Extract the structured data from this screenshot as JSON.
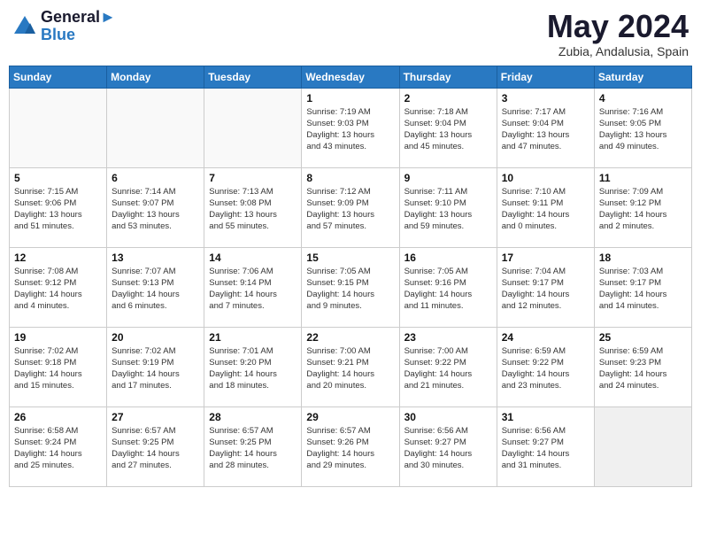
{
  "header": {
    "logo_line1": "General",
    "logo_line2": "Blue",
    "month": "May 2024",
    "location": "Zubia, Andalusia, Spain"
  },
  "weekdays": [
    "Sunday",
    "Monday",
    "Tuesday",
    "Wednesday",
    "Thursday",
    "Friday",
    "Saturday"
  ],
  "weeks": [
    [
      {
        "day": "",
        "info": ""
      },
      {
        "day": "",
        "info": ""
      },
      {
        "day": "",
        "info": ""
      },
      {
        "day": "1",
        "info": "Sunrise: 7:19 AM\nSunset: 9:03 PM\nDaylight: 13 hours\nand 43 minutes."
      },
      {
        "day": "2",
        "info": "Sunrise: 7:18 AM\nSunset: 9:04 PM\nDaylight: 13 hours\nand 45 minutes."
      },
      {
        "day": "3",
        "info": "Sunrise: 7:17 AM\nSunset: 9:04 PM\nDaylight: 13 hours\nand 47 minutes."
      },
      {
        "day": "4",
        "info": "Sunrise: 7:16 AM\nSunset: 9:05 PM\nDaylight: 13 hours\nand 49 minutes."
      }
    ],
    [
      {
        "day": "5",
        "info": "Sunrise: 7:15 AM\nSunset: 9:06 PM\nDaylight: 13 hours\nand 51 minutes."
      },
      {
        "day": "6",
        "info": "Sunrise: 7:14 AM\nSunset: 9:07 PM\nDaylight: 13 hours\nand 53 minutes."
      },
      {
        "day": "7",
        "info": "Sunrise: 7:13 AM\nSunset: 9:08 PM\nDaylight: 13 hours\nand 55 minutes."
      },
      {
        "day": "8",
        "info": "Sunrise: 7:12 AM\nSunset: 9:09 PM\nDaylight: 13 hours\nand 57 minutes."
      },
      {
        "day": "9",
        "info": "Sunrise: 7:11 AM\nSunset: 9:10 PM\nDaylight: 13 hours\nand 59 minutes."
      },
      {
        "day": "10",
        "info": "Sunrise: 7:10 AM\nSunset: 9:11 PM\nDaylight: 14 hours\nand 0 minutes."
      },
      {
        "day": "11",
        "info": "Sunrise: 7:09 AM\nSunset: 9:12 PM\nDaylight: 14 hours\nand 2 minutes."
      }
    ],
    [
      {
        "day": "12",
        "info": "Sunrise: 7:08 AM\nSunset: 9:12 PM\nDaylight: 14 hours\nand 4 minutes."
      },
      {
        "day": "13",
        "info": "Sunrise: 7:07 AM\nSunset: 9:13 PM\nDaylight: 14 hours\nand 6 minutes."
      },
      {
        "day": "14",
        "info": "Sunrise: 7:06 AM\nSunset: 9:14 PM\nDaylight: 14 hours\nand 7 minutes."
      },
      {
        "day": "15",
        "info": "Sunrise: 7:05 AM\nSunset: 9:15 PM\nDaylight: 14 hours\nand 9 minutes."
      },
      {
        "day": "16",
        "info": "Sunrise: 7:05 AM\nSunset: 9:16 PM\nDaylight: 14 hours\nand 11 minutes."
      },
      {
        "day": "17",
        "info": "Sunrise: 7:04 AM\nSunset: 9:17 PM\nDaylight: 14 hours\nand 12 minutes."
      },
      {
        "day": "18",
        "info": "Sunrise: 7:03 AM\nSunset: 9:17 PM\nDaylight: 14 hours\nand 14 minutes."
      }
    ],
    [
      {
        "day": "19",
        "info": "Sunrise: 7:02 AM\nSunset: 9:18 PM\nDaylight: 14 hours\nand 15 minutes."
      },
      {
        "day": "20",
        "info": "Sunrise: 7:02 AM\nSunset: 9:19 PM\nDaylight: 14 hours\nand 17 minutes."
      },
      {
        "day": "21",
        "info": "Sunrise: 7:01 AM\nSunset: 9:20 PM\nDaylight: 14 hours\nand 18 minutes."
      },
      {
        "day": "22",
        "info": "Sunrise: 7:00 AM\nSunset: 9:21 PM\nDaylight: 14 hours\nand 20 minutes."
      },
      {
        "day": "23",
        "info": "Sunrise: 7:00 AM\nSunset: 9:22 PM\nDaylight: 14 hours\nand 21 minutes."
      },
      {
        "day": "24",
        "info": "Sunrise: 6:59 AM\nSunset: 9:22 PM\nDaylight: 14 hours\nand 23 minutes."
      },
      {
        "day": "25",
        "info": "Sunrise: 6:59 AM\nSunset: 9:23 PM\nDaylight: 14 hours\nand 24 minutes."
      }
    ],
    [
      {
        "day": "26",
        "info": "Sunrise: 6:58 AM\nSunset: 9:24 PM\nDaylight: 14 hours\nand 25 minutes."
      },
      {
        "day": "27",
        "info": "Sunrise: 6:57 AM\nSunset: 9:25 PM\nDaylight: 14 hours\nand 27 minutes."
      },
      {
        "day": "28",
        "info": "Sunrise: 6:57 AM\nSunset: 9:25 PM\nDaylight: 14 hours\nand 28 minutes."
      },
      {
        "day": "29",
        "info": "Sunrise: 6:57 AM\nSunset: 9:26 PM\nDaylight: 14 hours\nand 29 minutes."
      },
      {
        "day": "30",
        "info": "Sunrise: 6:56 AM\nSunset: 9:27 PM\nDaylight: 14 hours\nand 30 minutes."
      },
      {
        "day": "31",
        "info": "Sunrise: 6:56 AM\nSunset: 9:27 PM\nDaylight: 14 hours\nand 31 minutes."
      },
      {
        "day": "",
        "info": ""
      }
    ]
  ]
}
